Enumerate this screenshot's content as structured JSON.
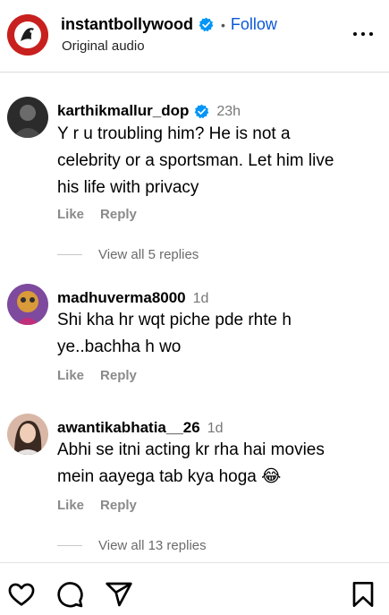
{
  "header": {
    "username": "instantbollywood",
    "separator": "•",
    "follow_label": "Follow",
    "subtitle": "Original audio",
    "avatar_icon": "instant-bollywood-logo",
    "verified_icon": "verified-badge-icon",
    "more_icon": "more-options-icon"
  },
  "comments": [
    {
      "username": "karthikmallur_dop",
      "verified": true,
      "time": "23h",
      "text_lines": [
        "Y r u troubling him? He is not a",
        "celebrity or a sportsman. Let him live",
        "his life with privacy"
      ],
      "like_label": "Like",
      "reply_label": "Reply",
      "view_replies": "View all 5 replies"
    },
    {
      "username": "madhuverma8000",
      "verified": false,
      "time": "1d",
      "text_lines": [
        "Shi kha hr wqt piche pde rhte h",
        "ye..bachha h wo"
      ],
      "like_label": "Like",
      "reply_label": "Reply"
    },
    {
      "username": "awantikabhatia__26",
      "verified": false,
      "time": "1d",
      "text_lines": [
        "Abhi se itni acting kr rha hai movies",
        "mein aayega tab kya hoga 😂"
      ],
      "like_label": "Like",
      "reply_label": "Reply",
      "view_replies": "View all 13 replies"
    }
  ],
  "bottom_bar": {
    "icons": [
      "heart-icon",
      "comment-icon",
      "share-icon",
      "bookmark-icon"
    ]
  },
  "colors": {
    "link_blue": "#0a58d8",
    "brand_red": "#c8201e",
    "secondary_text": "#8a8a8a"
  }
}
